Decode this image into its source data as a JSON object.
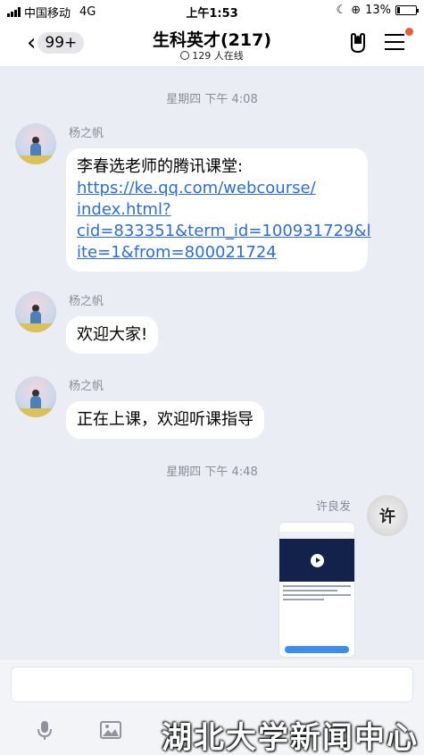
{
  "status_bar": {
    "carrier": "中国移动",
    "network": "4G",
    "time": "上午1:53",
    "battery": "13%"
  },
  "header": {
    "unread_count": "99+",
    "title": "生科英才(217)",
    "online": "129 人在线"
  },
  "messages": [
    {
      "type": "time",
      "text": "星期四 下午 4:08"
    },
    {
      "type": "text",
      "sender": "杨之帆",
      "line1": "李春选老师的腾讯课堂:",
      "link_lines": [
        "https://ke.qq.com/webcourse/",
        "index.html?",
        "cid=833351&term_id=100931729&l",
        "ite=1&from=800021724"
      ]
    },
    {
      "type": "text",
      "sender": "杨之帆",
      "text": "欢迎大家!"
    },
    {
      "type": "text",
      "sender": "杨之帆",
      "text": "正在上课，欢迎听课指导"
    },
    {
      "type": "time",
      "text": "星期四 下午 4:48"
    },
    {
      "type": "image",
      "sender": "许良发",
      "avatar_text": "许"
    }
  ],
  "input": {
    "placeholder": ""
  },
  "watermark": "湖北大学新闻中心",
  "colors": {
    "background": "#ebedf5",
    "link": "#2f6cd2",
    "badge_dot": "#ee5a3b"
  }
}
